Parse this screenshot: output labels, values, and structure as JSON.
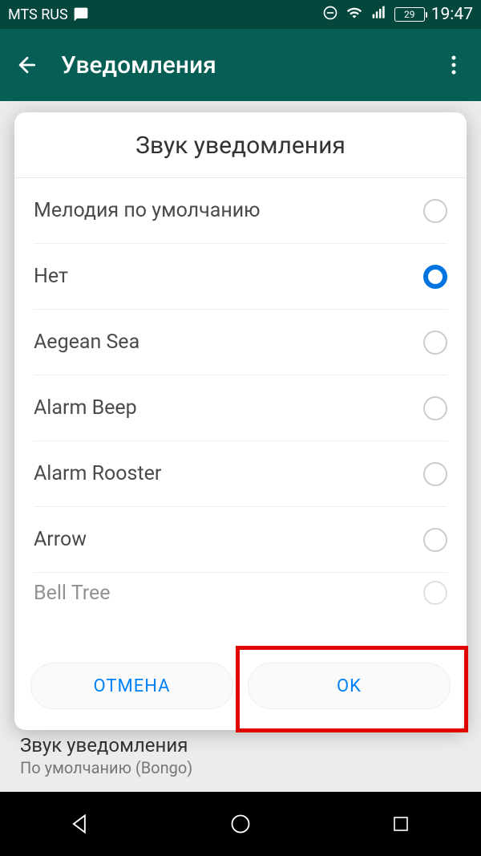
{
  "status": {
    "carrier": "MTS RUS",
    "battery": "29",
    "time": "19:47"
  },
  "appbar": {
    "title": "Уведомления"
  },
  "dialog": {
    "title": "Звук уведомления",
    "options": {
      "o0": "Мелодия по умолчанию",
      "o1": "Нет",
      "o2": "Aegean Sea",
      "o3": "Alarm Beep",
      "o4": "Alarm Rooster",
      "o5": "Arrow",
      "o6": "Bell Tree"
    },
    "selected_index": 1,
    "cancel_label": "ОТМЕНА",
    "ok_label": "OK"
  },
  "background_setting": {
    "title": "Звук уведомления",
    "value": "По умолчанию (Bongo)"
  }
}
